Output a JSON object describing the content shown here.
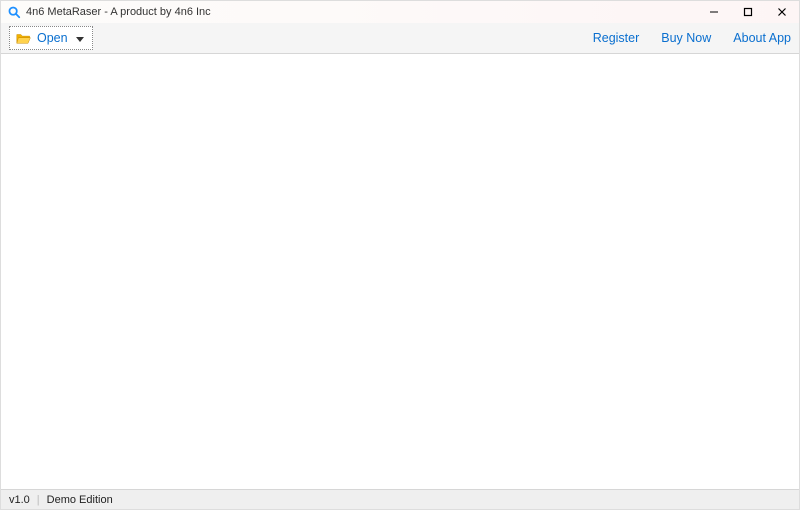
{
  "titlebar": {
    "title": "4n6 MetaRaser - A product by 4n6 Inc"
  },
  "toolbar": {
    "open_label": "Open",
    "links": {
      "register": "Register",
      "buy_now": "Buy Now",
      "about_app": "About App"
    }
  },
  "statusbar": {
    "version": "v1.0",
    "edition": "Demo Edition"
  },
  "colors": {
    "accent_link": "#0a6fcf"
  }
}
